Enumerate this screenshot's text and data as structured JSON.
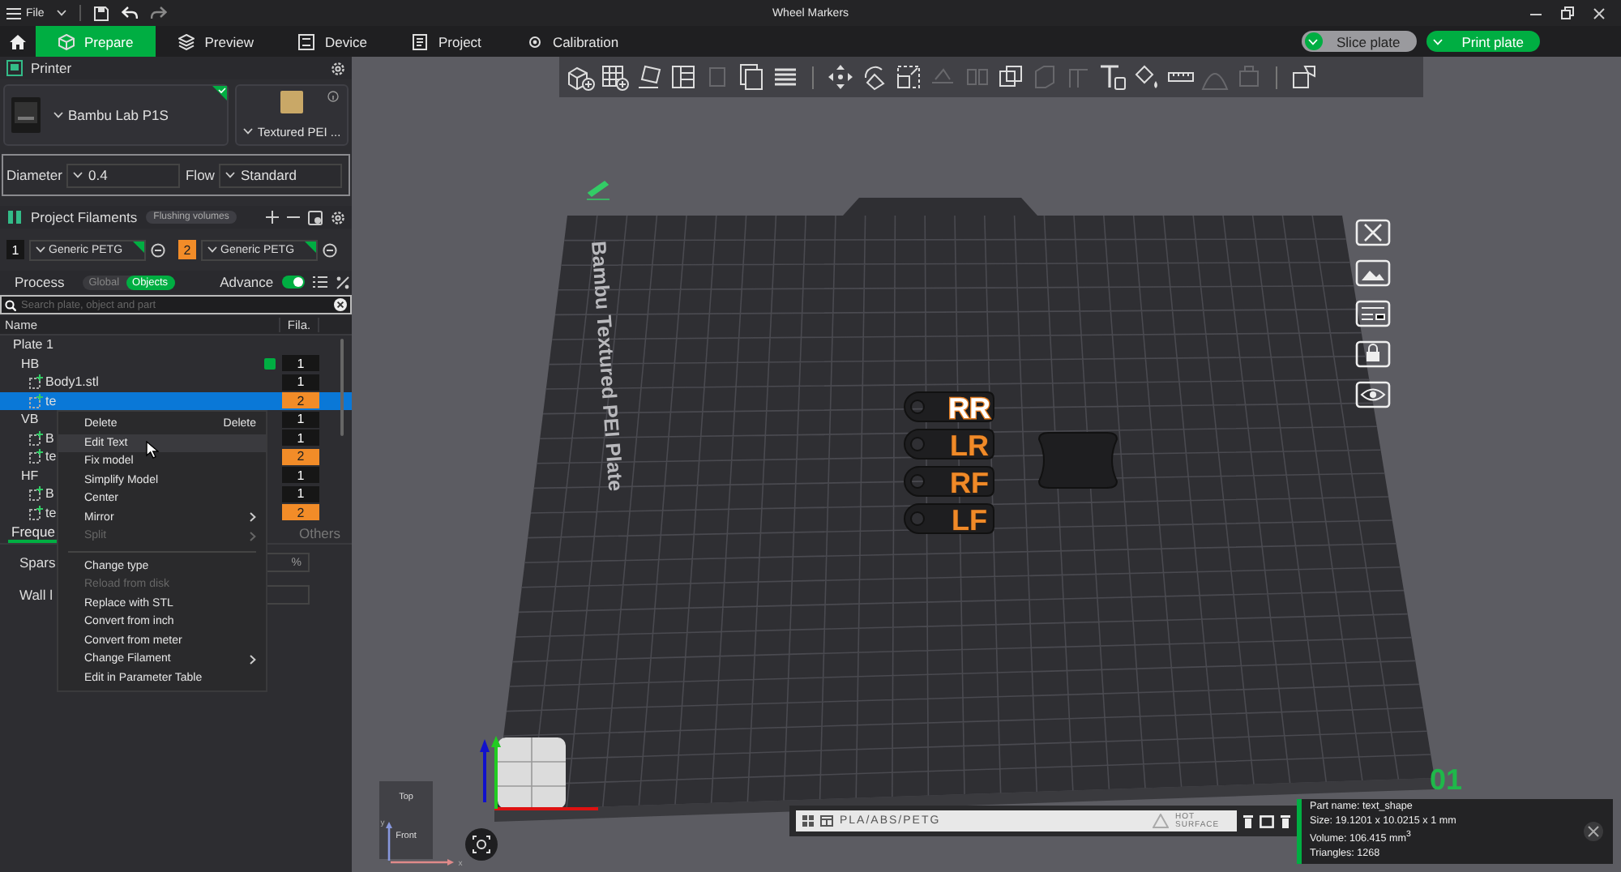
{
  "window": {
    "title": "Wheel Markers",
    "menu": "File"
  },
  "tabs": [
    {
      "label": "Prepare",
      "selected": true
    },
    {
      "label": "Preview",
      "selected": false
    },
    {
      "label": "Device",
      "selected": false
    },
    {
      "label": "Project",
      "selected": false
    },
    {
      "label": "Calibration",
      "selected": false
    }
  ],
  "actions": [
    {
      "label": "Slice plate",
      "kind": "secondary"
    },
    {
      "label": "Print plate",
      "kind": "primary"
    }
  ],
  "printer": {
    "title": "Printer",
    "model": "Bambu Lab P1S",
    "plate_type": "Textured PEI ...",
    "diameter_label": "Diameter",
    "diameter": "0.4",
    "flow_label": "Flow",
    "flow": "Standard"
  },
  "filaments": {
    "title": "Project Filaments",
    "flushing_button": "Flushing volumes",
    "items": [
      {
        "index": "1",
        "name": "Generic PETG",
        "color": "#161616"
      },
      {
        "index": "2",
        "name": "Generic PETG",
        "color": "#f28c28"
      }
    ]
  },
  "process": {
    "title": "Process",
    "modes": [
      {
        "label": "Global",
        "selected": false
      },
      {
        "label": "Objects",
        "selected": true
      }
    ],
    "advance_label": "Advance",
    "advance_on": true
  },
  "search": {
    "placeholder": "Search plate, object and part"
  },
  "object_list": {
    "columns": [
      "Name",
      "Fila."
    ],
    "plates": [
      {
        "name": "Plate 1",
        "selected": false,
        "children": [
          {
            "name": "HB",
            "checked": true,
            "filament": "1",
            "color": "#161616",
            "selected": false,
            "children": [
              {
                "name": "Body1.stl",
                "filament": "1",
                "color": "#161616",
                "selected": false
              },
              {
                "name": "te",
                "filament": "2",
                "color": "#f28c28",
                "selected": true
              }
            ]
          },
          {
            "name": "VB",
            "checked": false,
            "filament": "1",
            "color": "#161616",
            "selected": false,
            "children": [
              {
                "name": "B",
                "filament": "1",
                "color": "#161616",
                "selected": false
              },
              {
                "name": "te",
                "filament": "2",
                "color": "#f28c28",
                "selected": false
              }
            ]
          },
          {
            "name": "HF",
            "checked": false,
            "filament": "1",
            "color": "#161616",
            "selected": false,
            "children": [
              {
                "name": "B",
                "filament": "1",
                "color": "#161616",
                "selected": false
              },
              {
                "name": "te",
                "filament": "2",
                "color": "#f28c28",
                "selected": false
              }
            ]
          }
        ]
      }
    ]
  },
  "settings": {
    "tabs": [
      {
        "label": "Freque",
        "selected": true
      },
      {
        "label": "Others",
        "selected": false
      }
    ],
    "rows": [
      {
        "label": "Spars",
        "unit": "%"
      },
      {
        "label": "Wall l"
      }
    ]
  },
  "context_menu": [
    {
      "kind": "item",
      "label": "Delete",
      "shortcut": "Delete",
      "disabled": false,
      "selected": false,
      "submenu": false
    },
    {
      "kind": "item",
      "label": "Edit Text",
      "disabled": false,
      "selected": true,
      "submenu": false
    },
    {
      "kind": "item",
      "label": "Fix model",
      "disabled": false,
      "selected": false,
      "submenu": false
    },
    {
      "kind": "item",
      "label": "Simplify Model",
      "disabled": false,
      "selected": false,
      "submenu": false
    },
    {
      "kind": "item",
      "label": "Center",
      "disabled": false,
      "selected": false,
      "submenu": false
    },
    {
      "kind": "item",
      "label": "Mirror",
      "disabled": false,
      "selected": false,
      "submenu": true
    },
    {
      "kind": "item",
      "label": "Split",
      "disabled": true,
      "selected": false,
      "submenu": true
    },
    {
      "kind": "separator"
    },
    {
      "kind": "item",
      "label": "Change type",
      "disabled": false,
      "selected": false,
      "submenu": false
    },
    {
      "kind": "item",
      "label": "Reload from disk",
      "disabled": true,
      "selected": false,
      "submenu": false
    },
    {
      "kind": "item",
      "label": "Replace with STL",
      "disabled": false,
      "selected": false,
      "submenu": false
    },
    {
      "kind": "item",
      "label": "Convert from inch",
      "disabled": false,
      "selected": false,
      "submenu": false
    },
    {
      "kind": "item",
      "label": "Convert from meter",
      "disabled": false,
      "selected": false,
      "submenu": false
    },
    {
      "kind": "item",
      "label": "Change Filament",
      "disabled": false,
      "selected": false,
      "submenu": true
    },
    {
      "kind": "item",
      "label": "Edit in Parameter Table",
      "disabled": false,
      "selected": false,
      "submenu": false
    }
  ],
  "toolbar": [
    {
      "kind": "add-cube",
      "disabled": false
    },
    {
      "kind": "add-grid",
      "disabled": false
    },
    {
      "kind": "orient",
      "disabled": false
    },
    {
      "kind": "arrange",
      "disabled": false
    },
    {
      "kind": "box",
      "disabled": true
    },
    {
      "kind": "plates",
      "disabled": false
    },
    {
      "kind": "layers",
      "disabled": false
    },
    {
      "kind": "divider"
    },
    {
      "kind": "move",
      "disabled": false
    },
    {
      "kind": "rotate",
      "disabled": false
    },
    {
      "kind": "scale",
      "disabled": false
    },
    {
      "kind": "flat",
      "disabled": true
    },
    {
      "kind": "split",
      "disabled": true
    },
    {
      "kind": "boolean",
      "disabled": false
    },
    {
      "kind": "cut",
      "disabled": true
    },
    {
      "kind": "support",
      "disabled": true
    },
    {
      "kind": "text",
      "disabled": false
    },
    {
      "kind": "paint",
      "disabled": false
    },
    {
      "kind": "measure",
      "disabled": false
    },
    {
      "kind": "seam",
      "disabled": true
    },
    {
      "kind": "assemble",
      "disabled": true
    },
    {
      "kind": "divider"
    },
    {
      "kind": "explode",
      "disabled": false
    }
  ],
  "scene": {
    "plate_name": "Bambu Textured PEI Plate",
    "objects": [
      {
        "label": "RR",
        "selected": true
      },
      {
        "label": "LR",
        "selected": false
      },
      {
        "label": "RF",
        "selected": false
      },
      {
        "label": "LF",
        "selected": false
      }
    ],
    "plate_labels": [
      "PLA/ABS/PETG",
      "HOT SURFACE"
    ],
    "plate_number": "01"
  },
  "view_cube": {
    "top": "Top",
    "front": "Front",
    "x_axis": "x",
    "y_axis": "y"
  },
  "part_info": [
    "Part name: text_shape",
    "Size: 19.1201 x 10.0215 x 1 mm",
    "Volume: 106.415 mm$^{3}$",
    "Triangles: 1268"
  ]
}
